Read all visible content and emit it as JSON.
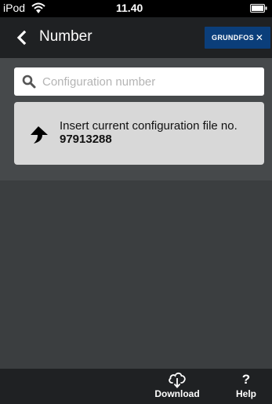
{
  "status_bar": {
    "device": "iPod",
    "time": "11.40"
  },
  "nav": {
    "title": "Number",
    "logo_text": "GRUNDFOS"
  },
  "search": {
    "placeholder": "Configuration number",
    "value": ""
  },
  "info_card": {
    "text": "Insert current configuration file no.",
    "number": "97913288"
  },
  "toolbar": {
    "download_label": "Download",
    "help_label": "Help",
    "help_glyph": "?"
  },
  "colors": {
    "status_bg": "#000000",
    "nav_bg": "#1f2123",
    "content_bg": "#46494b",
    "body_bg": "#3b3e40",
    "card_bg": "#d8d8d8",
    "logo_bg": "#0b3e7a"
  },
  "icons": {
    "wifi": "wifi-icon",
    "battery": "battery-icon",
    "back": "chevron-left-icon",
    "search": "search-icon",
    "upload": "upload-arrow-icon",
    "download": "cloud-download-icon"
  }
}
